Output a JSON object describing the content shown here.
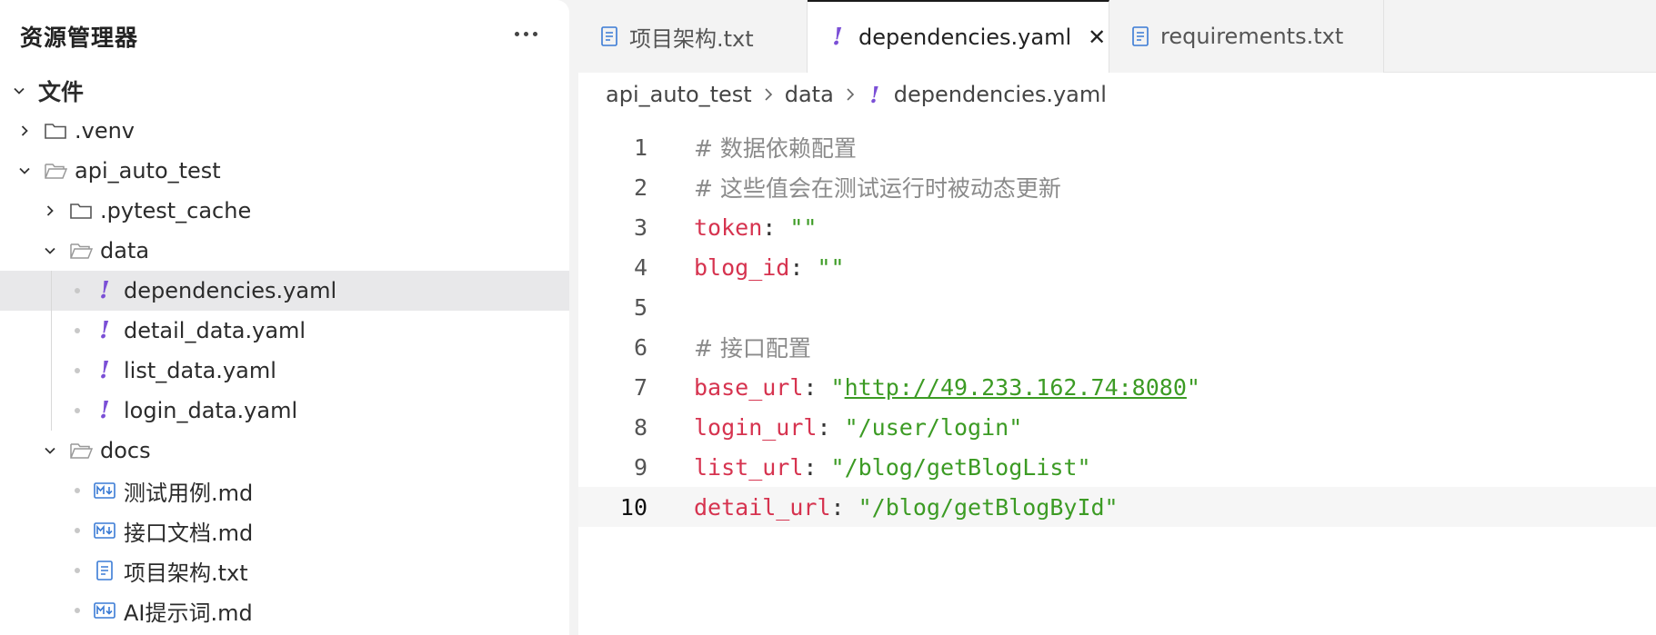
{
  "sidebar": {
    "title": "资源管理器",
    "root_label": "文件",
    "items": [
      {
        "label": ".venv"
      },
      {
        "label": "api_auto_test"
      },
      {
        "label": ".pytest_cache"
      },
      {
        "label": "data"
      },
      {
        "label": "dependencies.yaml"
      },
      {
        "label": "detail_data.yaml"
      },
      {
        "label": "list_data.yaml"
      },
      {
        "label": "login_data.yaml"
      },
      {
        "label": "docs"
      },
      {
        "label": "测试用例.md"
      },
      {
        "label": "接口文档.md"
      },
      {
        "label": "项目架构.txt"
      },
      {
        "label": "AI提示词.md"
      }
    ]
  },
  "tabs": [
    {
      "label": "项目架构.txt"
    },
    {
      "label": "dependencies.yaml"
    },
    {
      "label": "requirements.txt"
    }
  ],
  "breadcrumb": [
    "api_auto_test",
    "data",
    "dependencies.yaml"
  ],
  "code": {
    "lines": [
      {
        "num": "1",
        "comment": "# 数据依赖配置"
      },
      {
        "num": "2",
        "comment": "# 这些值会在测试运行时被动态更新"
      },
      {
        "num": "3",
        "key": "token",
        "colon": ": ",
        "value": "\"\""
      },
      {
        "num": "4",
        "key": "blog_id",
        "colon": ": ",
        "value": "\"\""
      },
      {
        "num": "5"
      },
      {
        "num": "6",
        "comment": "# 接口配置"
      },
      {
        "num": "7",
        "key": "base_url",
        "colon": ": ",
        "q1": "\"",
        "url": "http://49.233.162.74:8080",
        "q2": "\""
      },
      {
        "num": "8",
        "key": "login_url",
        "colon": ": ",
        "value": "\"/user/login\""
      },
      {
        "num": "9",
        "key": "list_url",
        "colon": ": ",
        "value": "\"/blog/getBlogList\""
      },
      {
        "num": "10",
        "key": "detail_url",
        "colon": ": ",
        "value": "\"/blog/getBlogById\""
      }
    ]
  },
  "colors": {
    "yaml_accent": "#7b4fd6",
    "md_icon": "#3a7bd5",
    "key": "#d6334f",
    "string": "#3c9b24",
    "comment": "#8b8b8b"
  }
}
